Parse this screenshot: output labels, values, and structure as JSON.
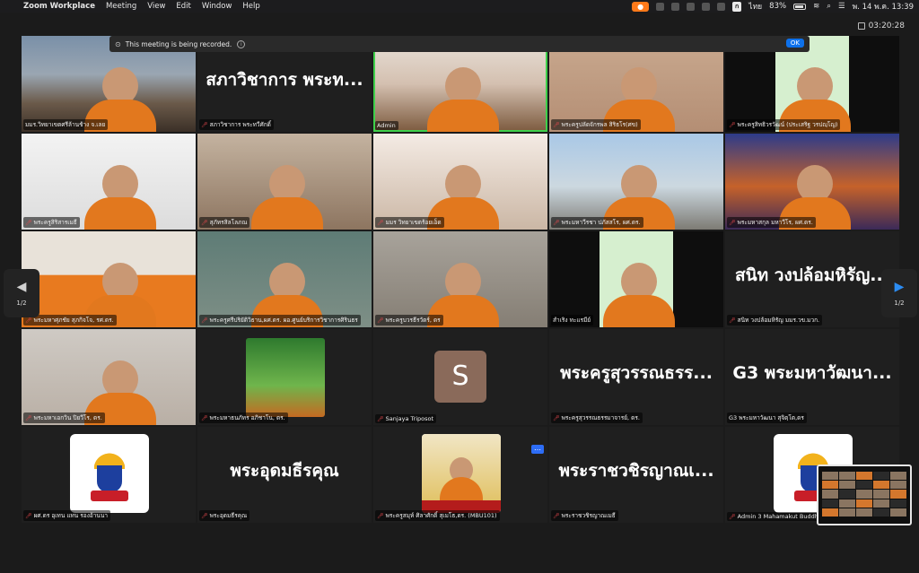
{
  "menubar": {
    "app_name": "Zoom Workplace",
    "menus": [
      "Meeting",
      "View",
      "Edit",
      "Window",
      "Help"
    ],
    "language": "ไทย",
    "battery": "83%",
    "clock": "พ. 14 พ.ค.  13:39"
  },
  "timer": "03:20:28",
  "recording": {
    "message": "This meeting is being recorded.",
    "ok_label": "OK"
  },
  "nav": {
    "left_page": "1/2",
    "right_page": "1/2"
  },
  "tiles": [
    {
      "name": "มมร.วิทยาเขตศรีล้านช้าง จ.เลย",
      "bg": "v-room",
      "muted": false
    },
    {
      "name": "สภาวิชาการ พระทวีศักดิ์",
      "big": "สภาวิชาการ พระท...",
      "bg": "",
      "muted": true
    },
    {
      "name": "Admin",
      "bg": "v-stage",
      "muted": false,
      "active": true
    },
    {
      "name": "พระครูปลัดจักรพล สิริธโร(ศข)",
      "bg": "v-wall",
      "muted": true
    },
    {
      "name": "พระครูสิทธิวรวัฒน์ (ประเสริฐ วรปญฺโญ)",
      "bg": "v-green",
      "muted": true
    },
    {
      "name": "พระครูสิริสารเมธี",
      "bg": "v-white",
      "muted": true
    },
    {
      "name": "สุภัทรสิลโลภณ",
      "bg": "v-beige",
      "muted": true
    },
    {
      "name": "มมร วิทยาเขตร้อยเอ็ด",
      "bg": "v-poster",
      "muted": true
    },
    {
      "name": "พระมหาวีรชา ปภัสสโร, ผศ.ดร.",
      "bg": "v-build",
      "muted": true
    },
    {
      "name": "พระมหาสกุล มหาวีโร, ผศ.ดร.",
      "bg": "v-temple",
      "muted": true
    },
    {
      "name": "พระมหาศุภชัย สุภกิจโจ, รศ.ดร.",
      "bg": "v-orange",
      "muted": true
    },
    {
      "name": "พระครูศรีปริยัติวิธาน,ผศ.ดร. ผอ.ศูนย์บริการวิชาการศิรินธร",
      "bg": "v-teal",
      "muted": true
    },
    {
      "name": "พระครูบวรธีรวัตร์, ดร",
      "bg": "v-gray",
      "muted": true
    },
    {
      "name": "สำเริง ทะแรมีย์",
      "bg": "v-green",
      "muted": false
    },
    {
      "name": "สนิท วงปล้อมหิรัญ มมร.วข.มวก.",
      "big": "สนิท วงปล้อมหิรัญ...",
      "bg": "",
      "muted": true
    },
    {
      "name": "พระมหาเอกวิน ปิยวีโร, ดร.",
      "bg": "v-blur",
      "muted": true
    },
    {
      "name": "พระมหาธนภัทร อภิชาโน, ดร.",
      "bg": "",
      "muted": true,
      "photo": true
    },
    {
      "name": "Sanjaya Triposot",
      "bg": "",
      "muted": true,
      "avatar": "S"
    },
    {
      "name": "พระครูสุวรรณธรรมาจารย์, ดร.",
      "big": "พระครูสุวรรณธรร...",
      "bg": "",
      "muted": true
    },
    {
      "name": "G3 พระมหาวัฒนา สุจิตฺโต,ดร",
      "big": "G3 พระมหาวัฒนา...",
      "bg": "",
      "muted": false
    },
    {
      "name": "ผศ.ดร อุเทน แทน รองอ้านนา",
      "bg": "",
      "muted": true,
      "emblem": true
    },
    {
      "name": "พระอุดมธีรคุณ",
      "big": "พระอุดมธีรคุณ",
      "bg": "",
      "muted": true
    },
    {
      "name": "พระครูสมุห์ ศิลาศักดิ์ สุเมโธ,ดร. (MBU101)",
      "bg": "",
      "muted": true,
      "profile": true
    },
    {
      "name": "พระราชวชิรญาณเมธี",
      "big": "พระราชวชิรญาณเ...",
      "bg": "",
      "muted": true
    },
    {
      "name": "Admin 3 Mahamakut Buddhist University",
      "bg": "",
      "muted": true,
      "emblem": true
    }
  ]
}
